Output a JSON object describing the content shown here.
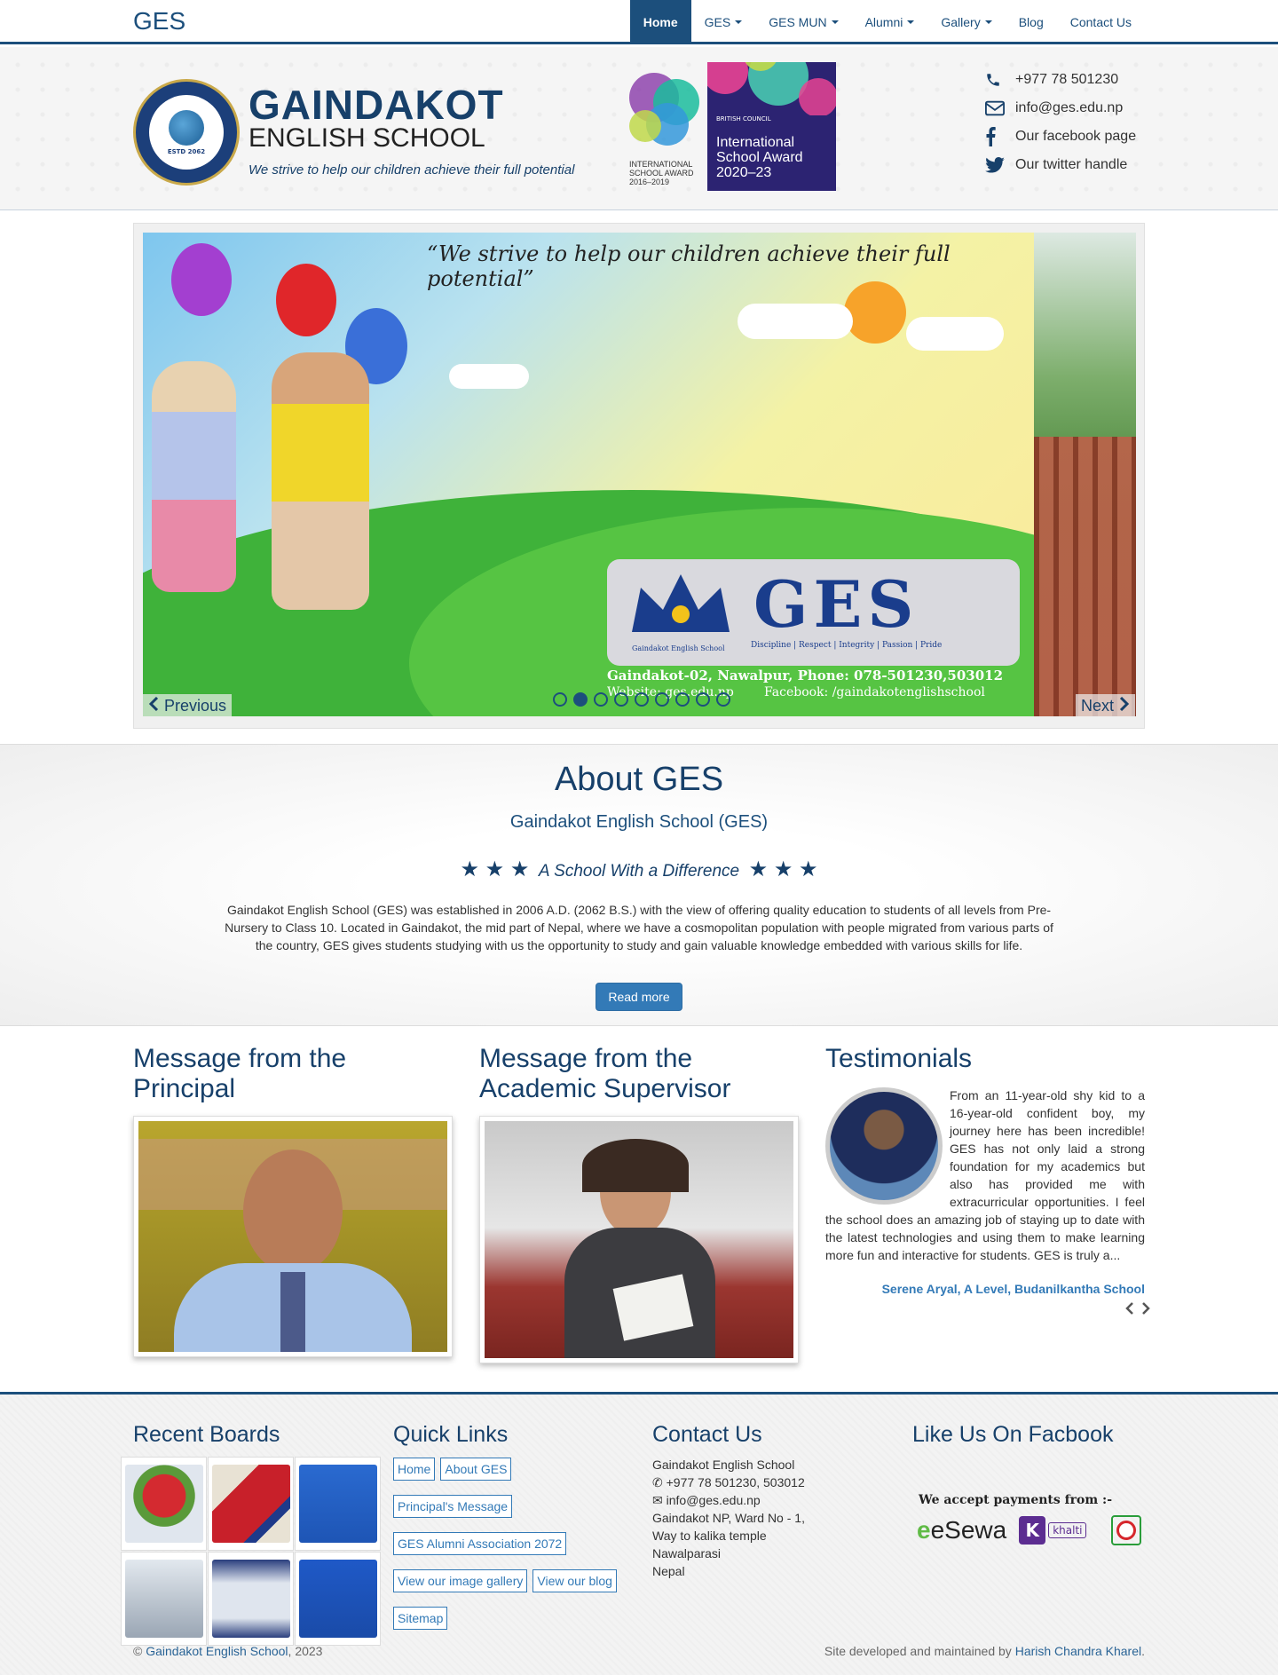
{
  "nav": {
    "brand": "GES",
    "items": [
      {
        "label": "Home",
        "dropdown": false,
        "active": true
      },
      {
        "label": "GES",
        "dropdown": true
      },
      {
        "label": "GES MUN",
        "dropdown": true
      },
      {
        "label": "Alumni",
        "dropdown": true
      },
      {
        "label": "Gallery",
        "dropdown": true
      },
      {
        "label": "Blog",
        "dropdown": false
      },
      {
        "label": "Contact Us",
        "dropdown": false
      }
    ]
  },
  "header": {
    "logo_text": "ESTD 2062",
    "name_line1": "GAINDAKOT",
    "name_line2": "ENGLISH SCHOOL",
    "tagline": "We strive to help our children achieve their full potential",
    "award_small": {
      "line1": "INTERNATIONAL",
      "line2": "SCHOOL AWARD",
      "line3": "2016–2019"
    },
    "award_big": {
      "council": "BRITISH COUNCIL",
      "title": "International School Award",
      "years": "2020–23"
    },
    "contacts": [
      {
        "icon": "phone-icon",
        "text": "+977 78 501230"
      },
      {
        "icon": "envelope-icon",
        "text": "info@ges.edu.np"
      },
      {
        "icon": "facebook-icon",
        "text": "Our facebook page"
      },
      {
        "icon": "twitter-icon",
        "text": "Our twitter handle"
      }
    ]
  },
  "carousel": {
    "quote": "“We strive to help our children achieve their full potential”",
    "card_title": "GES",
    "card_school": "Gaindakot English School",
    "card_values": "Discipline | Respect | Integrity | Passion | Pride",
    "address": "Gaindakot-02, Nawalpur, Phone: 078-501230,503012",
    "website": "Website: ges.edu.np",
    "facebook": "Facebook: /gaindakotenglishschool",
    "prev_label": "Previous",
    "next_label": "Next",
    "slide_count": 9,
    "active_index": 1
  },
  "about": {
    "title": "About GES",
    "subtitle": "Gaindakot English School (GES)",
    "tagline": "A School With a Difference",
    "body": "Gaindakot English School (GES) was established in 2006 A.D. (2062 B.S.) with the view of offering quality education to students of all levels from Pre-Nursery to Class 10. Located in Gaindakot, the mid part of Nepal, where we have a cosmopolitan population with people migrated from various parts of the country, GES gives students studying with us the opportunity to study and gain valuable knowledge embedded with various skills for life.",
    "read_more": "Read more"
  },
  "principal": {
    "title": "Message from the Principal"
  },
  "supervisor": {
    "title": "Message from the Academic Supervisor"
  },
  "testimonials": {
    "title": "Testimonials",
    "text": "From an 11-year-old shy kid to a 16-year-old confident boy, my journey here has been incredible! GES has not only laid a strong foundation for my academics but also has provided me with extracurricular opportunities. I feel the school does an amazing job of staying up to date with the latest technologies and using them to make learning more fun and interactive for students. GES is truly a...",
    "author": "Serene Aryal, A Level, Budanilkantha School"
  },
  "footer": {
    "boards_title": "Recent Boards",
    "links_title": "Quick Links",
    "links": [
      "Home",
      "About GES",
      "Principal's Message",
      "GES Alumni Association 2072",
      "View our image gallery",
      "View our blog",
      "Sitemap"
    ],
    "contact_title": "Contact Us",
    "contact": {
      "name": "Gaindakot English School",
      "phone": "+977 78 501230, 503012",
      "email": "info@ges.edu.np",
      "address1": "Gaindakot NP, Ward No - 1,",
      "address2": "Way to kalika temple",
      "district": "Nawalparasi",
      "country": "Nepal"
    },
    "like_title": "Like Us On Facbook",
    "payments_title": "We accept payments from :-",
    "esewa": "eSewa",
    "khalti": "khalti",
    "copyright_prefix": "©",
    "copyright_link": "Gaindakot English School",
    "copyright_suffix": ", 2023",
    "credit_prefix": "Site developed and maintained by",
    "credit_link": "Harish Chandra Kharel",
    "credit_suffix": "."
  }
}
